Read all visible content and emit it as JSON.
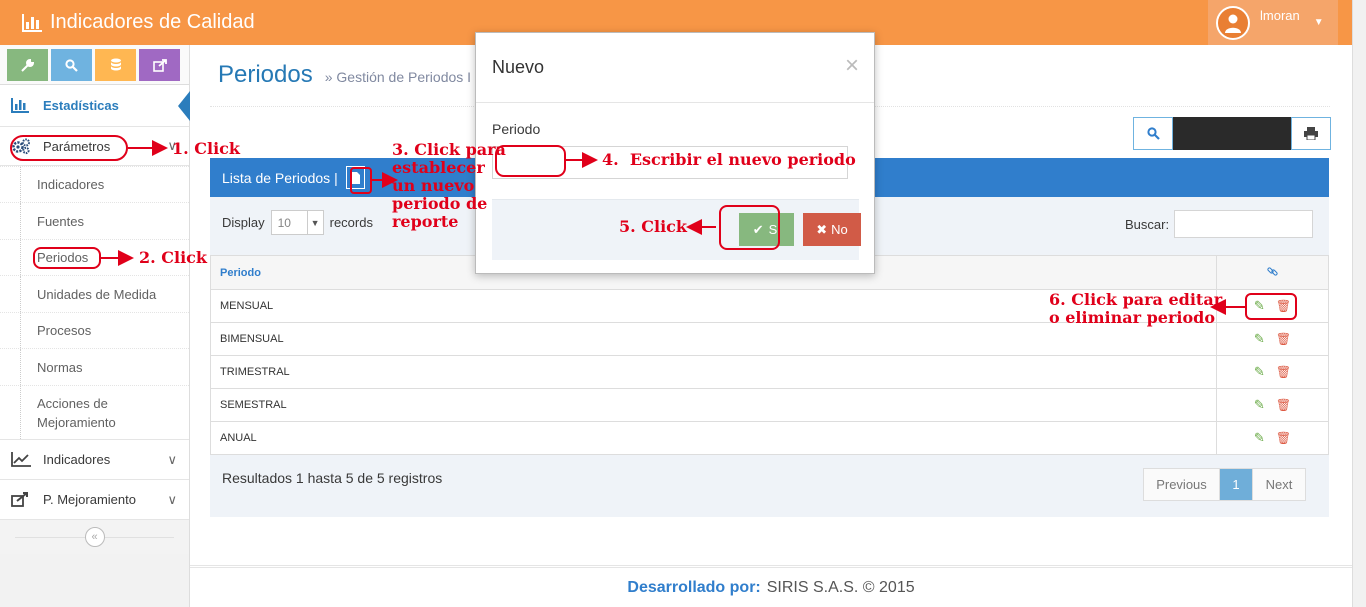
{
  "app": {
    "title": "Indicadores de Calidad"
  },
  "user": {
    "name": "lmoran"
  },
  "sidebar": {
    "stats_label": "Estadísticas",
    "parametros_label": "Parámetros",
    "sub_items": [
      "Indicadores",
      "Fuentes",
      "Periodos",
      "Unidades de Medida",
      "Procesos",
      "Normas",
      "Acciones de Mejoramiento"
    ],
    "indicadores_label": "Indicadores",
    "mejoramiento_label": "P. Mejoramiento"
  },
  "page": {
    "title": "Periodos",
    "subtitle": "» Gestión de Periodos I"
  },
  "panel": {
    "header": "Lista de Periodos |",
    "display_label": "Display",
    "display_value": "10",
    "records_label": "records",
    "search_label": "Buscar:",
    "column_periodo": "Periodo",
    "rows": [
      "MENSUAL",
      "BIMENSUAL",
      "TRIMESTRAL",
      "SEMESTRAL",
      "ANUAL"
    ],
    "results": "Resultados 1 hasta 5 de 5 registros",
    "prev": "Previous",
    "page": "1",
    "next": "Next"
  },
  "modal": {
    "title": "Nuevo",
    "close": "×",
    "label": "Periodo",
    "btn_si": "Si",
    "btn_no": "No"
  },
  "footer": {
    "dev_label": "Desarrollado por:",
    "company": "SIRIS S.A.S. © 2015"
  },
  "annotations": {
    "a1": "1. Click",
    "a2": "2. Click",
    "a3_l1": "3. Click para",
    "a3_l2": "establecer",
    "a3_l3": "un nuevo",
    "a3_l4": "periodo de",
    "a3_l5": "reporte",
    "a4": "4.  Escribir el nuevo periodo",
    "a5": "5. Click",
    "a6_l1": "6. Click para editar",
    "a6_l2": "o eliminar periodo"
  },
  "colors": {
    "navbar": "#f79646",
    "primary": "#307ecc",
    "annotation": "#e0001a"
  }
}
